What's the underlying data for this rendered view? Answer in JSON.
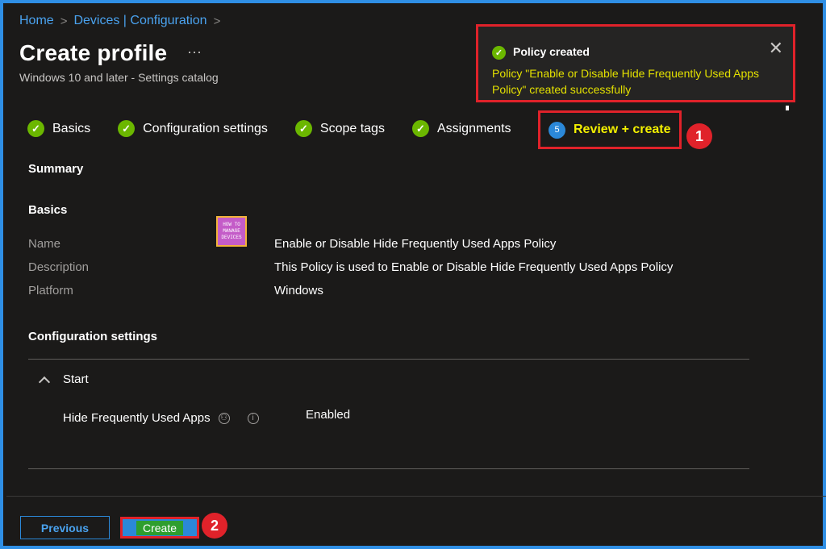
{
  "breadcrumb": {
    "home": "Home",
    "devices": "Devices | Configuration"
  },
  "header": {
    "title": "Create profile",
    "more": "···",
    "subtitle": "Windows 10 and later - Settings catalog"
  },
  "toast": {
    "title": "Policy created",
    "message": "Policy \"Enable or Disable Hide Frequently Used Apps Policy\" created successfully"
  },
  "steps": [
    {
      "label": "Basics"
    },
    {
      "label": "Configuration settings"
    },
    {
      "label": "Scope tags"
    },
    {
      "label": "Assignments"
    }
  ],
  "active_step": {
    "number": "5",
    "label": "Review + create"
  },
  "callouts": {
    "one": "1",
    "two": "2"
  },
  "summary": {
    "heading": "Summary",
    "basics_heading": "Basics",
    "rows": [
      {
        "label": "Name",
        "value": "Enable or Disable Hide Frequently Used Apps Policy"
      },
      {
        "label": "Description",
        "value": "This Policy is used to Enable or Disable Hide Frequently Used Apps Policy"
      },
      {
        "label": "Platform",
        "value": "Windows"
      }
    ],
    "config_heading": "Configuration settings",
    "category": "Start",
    "setting": {
      "name": "Hide Frequently Used Apps",
      "value": "Enabled"
    }
  },
  "logo": {
    "line1": "HOW TO",
    "line2": "MANAGE",
    "line3": "DEVICES"
  },
  "footer": {
    "previous": "Previous",
    "create": "Create"
  },
  "colors": {
    "accent": "#2b88d8",
    "success": "#6bb700",
    "highlight": "#e0222a"
  }
}
